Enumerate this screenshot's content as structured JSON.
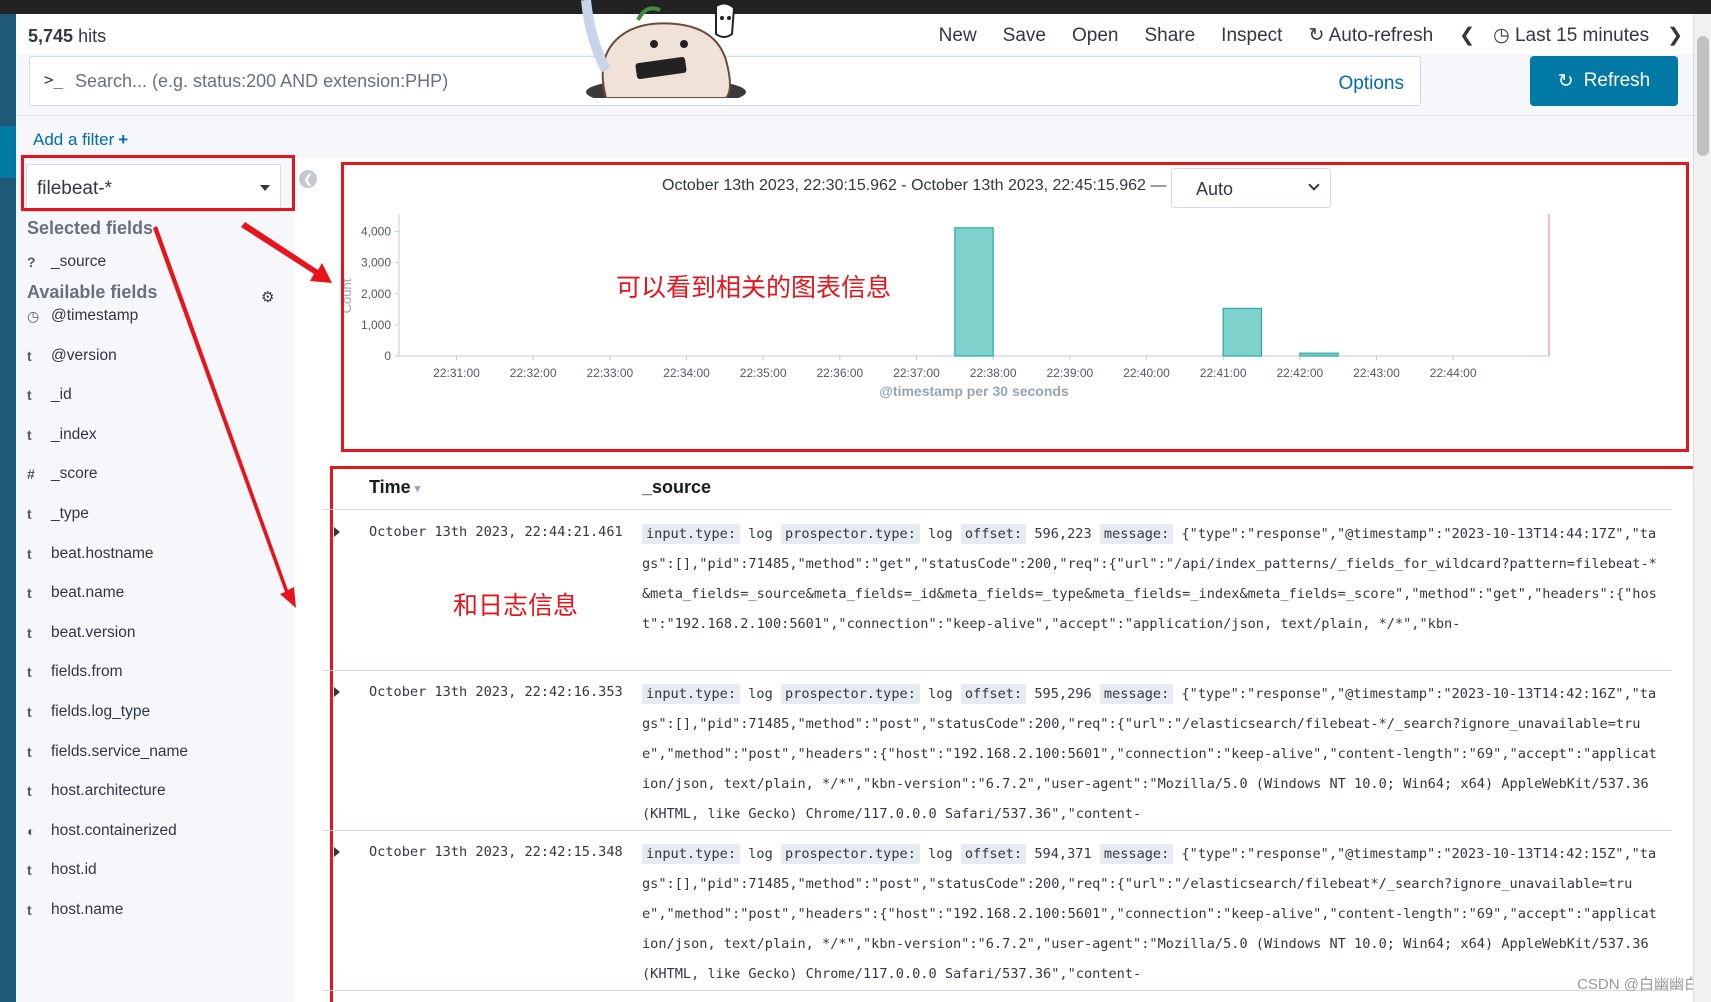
{
  "header": {
    "hits_count": "5,745",
    "hits_label": "hits",
    "nav": [
      "New",
      "Save",
      "Open",
      "Share",
      "Inspect"
    ],
    "auto_refresh": "Auto-refresh",
    "time_picker": "Last 15 minutes"
  },
  "search": {
    "prompt": ">_",
    "placeholder": "Search... (e.g. status:200 AND extension:PHP)",
    "options": "Options",
    "refresh": "Refresh"
  },
  "filters": {
    "add": "Add a filter",
    "plus": "+"
  },
  "sidebar": {
    "index_pattern": "filebeat-*",
    "selected_heading": "Selected fields",
    "selected_fields": [
      {
        "type": "?",
        "name": "_source"
      }
    ],
    "available_heading": "Available fields",
    "available_fields": [
      {
        "type": "clock",
        "name": "@timestamp"
      },
      {
        "type": "t",
        "name": "@version"
      },
      {
        "type": "t",
        "name": "_id"
      },
      {
        "type": "t",
        "name": "_index"
      },
      {
        "type": "#",
        "name": "_score"
      },
      {
        "type": "t",
        "name": "_type"
      },
      {
        "type": "t",
        "name": "beat.hostname"
      },
      {
        "type": "t",
        "name": "beat.name"
      },
      {
        "type": "t",
        "name": "beat.version"
      },
      {
        "type": "t",
        "name": "fields.from"
      },
      {
        "type": "t",
        "name": "fields.log_type"
      },
      {
        "type": "t",
        "name": "fields.service_name"
      },
      {
        "type": "t",
        "name": "host.architecture"
      },
      {
        "type": "bool",
        "name": "host.containerized"
      },
      {
        "type": "t",
        "name": "host.id"
      },
      {
        "type": "t",
        "name": "host.name"
      }
    ]
  },
  "chart": {
    "time_range": "October 13th 2023, 22:30:15.962 - October 13th 2023, 22:45:15.962 —",
    "interval": "Auto"
  },
  "chart_data": {
    "type": "bar",
    "xlabel": "@timestamp per 30 seconds",
    "ylabel": "Count",
    "xlim": [
      "22:30:15",
      "22:45:15"
    ],
    "ylim": [
      0,
      4500
    ],
    "yticks": [
      0,
      1000,
      2000,
      3000,
      4000
    ],
    "ytick_labels": [
      "0",
      "1,000",
      "2,000",
      "3,000",
      "4,000"
    ],
    "xticks": [
      "22:31:00",
      "22:32:00",
      "22:33:00",
      "22:34:00",
      "22:35:00",
      "22:36:00",
      "22:37:00",
      "22:38:00",
      "22:39:00",
      "22:40:00",
      "22:41:00",
      "22:42:00",
      "22:43:00",
      "22:44:00"
    ],
    "bars": [
      {
        "x": "22:37:30",
        "value": 4120
      },
      {
        "x": "22:41:00",
        "value": 1530
      },
      {
        "x": "22:42:00",
        "value": 90
      }
    ],
    "bar_color": "#7fd1cc",
    "bar_stroke": "#2aa9a0"
  },
  "annotations": {
    "chart_note": "可以看到相关的图表信息",
    "log_note": "和日志信息",
    "color": "#e8141c"
  },
  "table": {
    "col_time": "Time",
    "col_source": "_source",
    "sort_glyph": "▾",
    "rows": [
      {
        "time": "October 13th 2023, 22:44:21.461",
        "input_type": "log",
        "prospector_type": "log",
        "offset": "596,223",
        "message": "{\"type\":\"response\",\"@timestamp\":\"2023-10-13T14:44:17Z\",\"tags\":[],\"pid\":71485,\"method\":\"get\",\"statusCode\":200,\"req\":{\"url\":\"/api/index_patterns/_fields_for_wildcard?pattern=filebeat-*&meta_fields=_source&meta_fields=_id&meta_fields=_type&meta_fields=_index&meta_fields=_score\",\"method\":\"get\",\"headers\":{\"host\":\"192.168.2.100:5601\",\"connection\":\"keep-alive\",\"accept\":\"application/json, text/plain, */*\",\"kbn-"
      },
      {
        "time": "October 13th 2023, 22:42:16.353",
        "input_type": "log",
        "prospector_type": "log",
        "offset": "595,296",
        "message": "{\"type\":\"response\",\"@timestamp\":\"2023-10-13T14:42:16Z\",\"tags\":[],\"pid\":71485,\"method\":\"post\",\"statusCode\":200,\"req\":{\"url\":\"/elasticsearch/filebeat-*/_search?ignore_unavailable=true\",\"method\":\"post\",\"headers\":{\"host\":\"192.168.2.100:5601\",\"connection\":\"keep-alive\",\"content-length\":\"69\",\"accept\":\"application/json, text/plain, */*\",\"kbn-version\":\"6.7.2\",\"user-agent\":\"Mozilla/5.0 (Windows NT 10.0; Win64; x64) AppleWebKit/537.36 (KHTML, like Gecko) Chrome/117.0.0.0 Safari/537.36\",\"content-"
      },
      {
        "time": "October 13th 2023, 22:42:15.348",
        "input_type": "log",
        "prospector_type": "log",
        "offset": "594,371",
        "message": "{\"type\":\"response\",\"@timestamp\":\"2023-10-13T14:42:15Z\",\"tags\":[],\"pid\":71485,\"method\":\"post\",\"statusCode\":200,\"req\":{\"url\":\"/elasticsearch/filebeat*/_search?ignore_unavailable=true\",\"method\":\"post\",\"headers\":{\"host\":\"192.168.2.100:5601\",\"connection\":\"keep-alive\",\"content-length\":\"69\",\"accept\":\"application/json, text/plain, */*\",\"kbn-version\":\"6.7.2\",\"user-agent\":\"Mozilla/5.0 (Windows NT 10.0; Win64; x64) AppleWebKit/537.36 (KHTML, like Gecko) Chrome/117.0.0.0 Safari/537.36\",\"content-"
      }
    ],
    "key_input": "input.type:",
    "key_prospector": "prospector.type:",
    "key_offset": "offset:",
    "key_message": "message:"
  },
  "watermark": "CSDN @白幽幽白",
  "colors": {
    "accent": "#0079a5",
    "link": "#006bb4",
    "nav_rail": "#1d5a79"
  }
}
